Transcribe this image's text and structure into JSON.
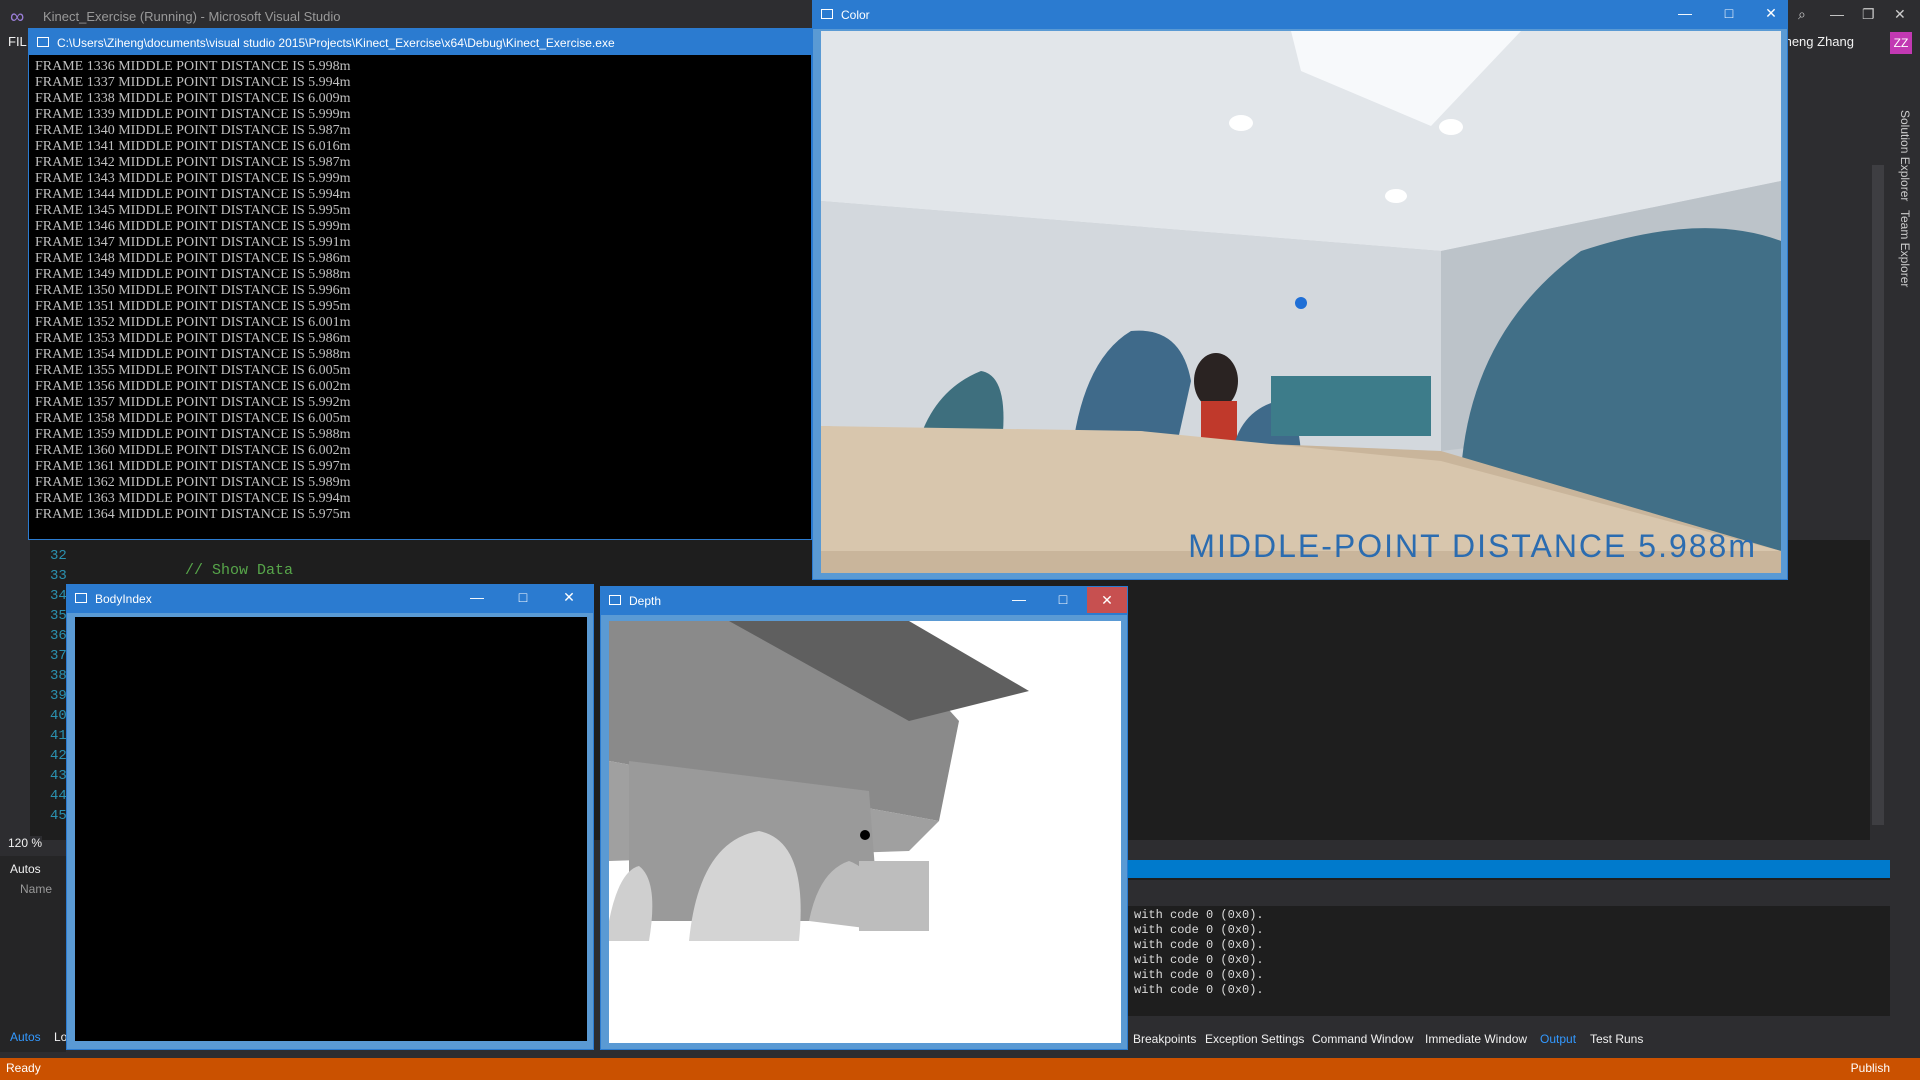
{
  "vs": {
    "title": "Kinect_Exercise (Running) - Microsoft Visual Studio",
    "menu_file": "FIL",
    "user_name": "Ziheng Zhang",
    "user_initials": "ZZ",
    "zoom": "120 %",
    "status": "Ready",
    "publish": "Publish"
  },
  "editor": {
    "line_numbers": [
      "32",
      "33",
      "34",
      "35",
      "36",
      "37",
      "38",
      "39",
      "40",
      "41",
      "42",
      "43",
      "44",
      "45"
    ],
    "comment": "// Show Data"
  },
  "right_strip": {
    "solution_explorer": "Solution Explorer",
    "team_explorer": "Team Explorer"
  },
  "autos": {
    "title": "Autos",
    "name_header": "Name",
    "tab_autos": "Autos",
    "tab_locals": "Lo"
  },
  "output": {
    "lines": [
      "with code 0 (0x0).",
      "with code 0 (0x0).",
      "with code 0 (0x0).",
      "with code 0 (0x0).",
      "with code 0 (0x0).",
      "with code 0 (0x0)."
    ]
  },
  "bottom_tabs": [
    "Breakpoints",
    "Exception Settings",
    "Command Window",
    "Immediate Window",
    "Output",
    "Test Runs"
  ],
  "console": {
    "title": "C:\\Users\\Ziheng\\documents\\visual studio 2015\\Projects\\Kinect_Exercise\\x64\\Debug\\Kinect_Exercise.exe",
    "lines": [
      "FRAME 1336 MIDDLE POINT DISTANCE IS 5.998m",
      "FRAME 1337 MIDDLE POINT DISTANCE IS 5.994m",
      "FRAME 1338 MIDDLE POINT DISTANCE IS 6.009m",
      "FRAME 1339 MIDDLE POINT DISTANCE IS 5.999m",
      "FRAME 1340 MIDDLE POINT DISTANCE IS 5.987m",
      "FRAME 1341 MIDDLE POINT DISTANCE IS 6.016m",
      "FRAME 1342 MIDDLE POINT DISTANCE IS 5.987m",
      "FRAME 1343 MIDDLE POINT DISTANCE IS 5.999m",
      "FRAME 1344 MIDDLE POINT DISTANCE IS 5.994m",
      "FRAME 1345 MIDDLE POINT DISTANCE IS 5.995m",
      "FRAME 1346 MIDDLE POINT DISTANCE IS 5.999m",
      "FRAME 1347 MIDDLE POINT DISTANCE IS 5.991m",
      "FRAME 1348 MIDDLE POINT DISTANCE IS 5.986m",
      "FRAME 1349 MIDDLE POINT DISTANCE IS 5.988m",
      "FRAME 1350 MIDDLE POINT DISTANCE IS 5.996m",
      "FRAME 1351 MIDDLE POINT DISTANCE IS 5.995m",
      "FRAME 1352 MIDDLE POINT DISTANCE IS 6.001m",
      "FRAME 1353 MIDDLE POINT DISTANCE IS 5.986m",
      "FRAME 1354 MIDDLE POINT DISTANCE IS 5.988m",
      "FRAME 1355 MIDDLE POINT DISTANCE IS 6.005m",
      "FRAME 1356 MIDDLE POINT DISTANCE IS 6.002m",
      "FRAME 1357 MIDDLE POINT DISTANCE IS 5.992m",
      "FRAME 1358 MIDDLE POINT DISTANCE IS 6.005m",
      "FRAME 1359 MIDDLE POINT DISTANCE IS 5.988m",
      "FRAME 1360 MIDDLE POINT DISTANCE IS 6.002m",
      "FRAME 1361 MIDDLE POINT DISTANCE IS 5.997m",
      "FRAME 1362 MIDDLE POINT DISTANCE IS 5.989m",
      "FRAME 1363 MIDDLE POINT DISTANCE IS 5.994m",
      "FRAME 1364 MIDDLE POINT DISTANCE IS 5.975m"
    ]
  },
  "color_window": {
    "title": "Color",
    "overlay": "MIDDLE-POINT DISTANCE 5.988m"
  },
  "body_window": {
    "title": "BodyIndex"
  },
  "depth_window": {
    "title": "Depth"
  },
  "icons": {
    "minimize": "minimize-icon",
    "maximize": "maximize-icon",
    "close": "close-icon"
  },
  "colors": {
    "accent": "#007acc",
    "window_title": "#2b7bd0",
    "status_bar": "#ca5100",
    "close_red": "#c75050"
  }
}
